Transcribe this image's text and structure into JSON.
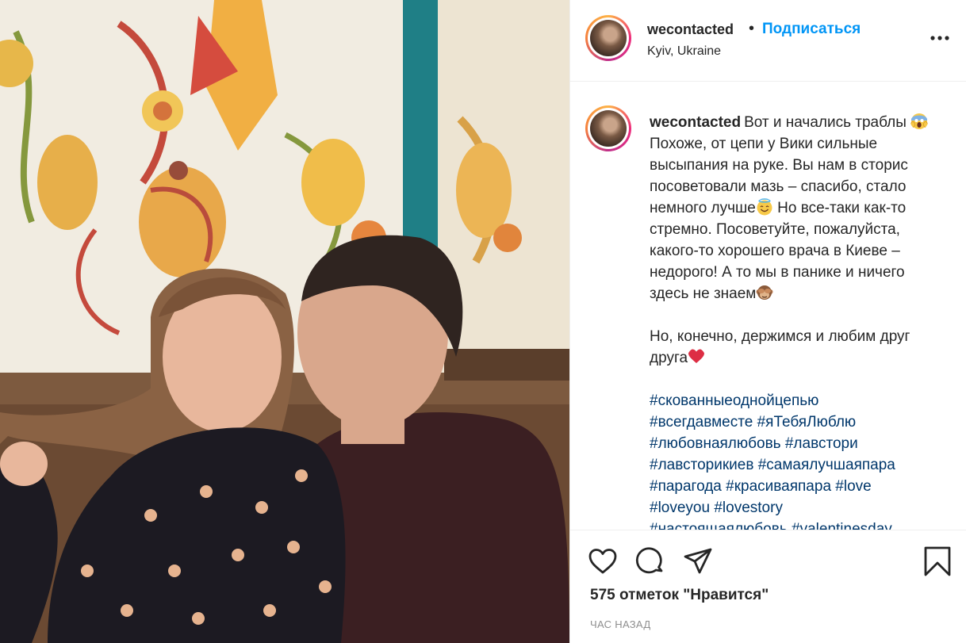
{
  "post": {
    "username": "wecontacted",
    "separator": "•",
    "follow_label": "Подписаться",
    "location": "Kyiv, Ukraine"
  },
  "caption": {
    "username": "wecontacted",
    "part1": "Вот и начались траблы",
    "part2": "Похоже, от цепи у Вики сильные высыпания на руке. Вы нам в сторис посоветовали мазь – спасибо, стало немного лучше",
    "part3": "Но все-таки как-то стремно. Посоветуйте, пожалуйста, какого-то хорошего врача в Киеве – недорого! А то мы в панике и ничего здесь не знаем",
    "part4": "Но, конечно, держимся и любим друг друга",
    "hashtags": [
      "#скованныеоднойцепью",
      "#всегдавместе",
      "#яТебяЛюблю",
      "#любовнаялюбовь",
      "#лавстори",
      "#лавсторикиев",
      "#самаялучшаяпара",
      "#парагода",
      "#красиваяпара",
      "#love",
      "#loveyou",
      "#lovestory",
      "#настоящаялюбовь",
      "#valentinesday"
    ]
  },
  "emojis": [
    "face-screaming-emoji",
    "smiling-halo-emoji",
    "see-no-evil-monkey-emoji",
    "red-heart-emoji"
  ],
  "actions": {
    "likes": "575 отметок \"Нравится\"",
    "time": "ЧАС НАЗАД"
  },
  "colors": {
    "follow_blue": "#0095f6",
    "hashtag_blue": "#00376b",
    "text": "#262626",
    "muted": "#8e8e8e",
    "story_ring": [
      "#fdb246",
      "#ee2a7b",
      "#c0308b"
    ]
  }
}
